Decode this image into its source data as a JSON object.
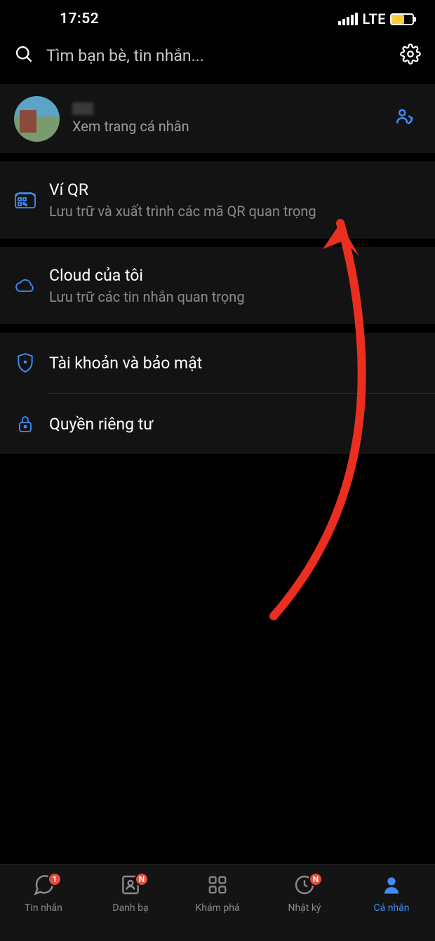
{
  "status": {
    "time": "17:52",
    "network": "LTE"
  },
  "search": {
    "placeholder": "Tìm bạn bè, tin nhắn..."
  },
  "profile": {
    "subtitle": "Xem trang cá nhân"
  },
  "menu": {
    "qr": {
      "title": "Ví QR",
      "subtitle": "Lưu trữ và xuất trình các mã QR quan trọng"
    },
    "cloud": {
      "title": "Cloud của tôi",
      "subtitle": "Lưu trữ các tin nhắn quan trọng"
    },
    "security": {
      "title": "Tài khoản và bảo mật"
    },
    "privacy": {
      "title": "Quyền riêng tư"
    }
  },
  "tabs": {
    "messages": {
      "label": "Tin nhắn",
      "badge": "1"
    },
    "contacts": {
      "label": "Danh bạ",
      "badge": "N"
    },
    "discover": {
      "label": "Khám phá"
    },
    "diary": {
      "label": "Nhật ký",
      "badge": "N"
    },
    "profile": {
      "label": "Cá nhân"
    }
  },
  "colors": {
    "accent": "#3E8EF7",
    "badge": "#E74C3C",
    "annotation": "#EA2E1F"
  }
}
